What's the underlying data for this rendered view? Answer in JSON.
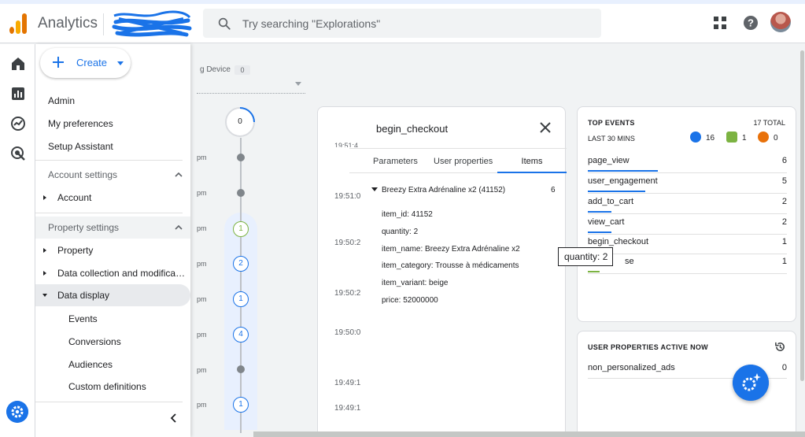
{
  "header": {
    "app_title": "Analytics",
    "search_placeholder": "Try searching \"Explorations\""
  },
  "menu": {
    "create_label": "Create",
    "items": {
      "admin": "Admin",
      "my_preferences": "My preferences",
      "setup_assistant": "Setup Assistant",
      "account_settings": "Account settings",
      "account": "Account",
      "property_settings": "Property settings",
      "property": "Property",
      "data_collection": "Data collection and modifica…",
      "data_display": "Data display",
      "events": "Events",
      "conversions": "Conversions",
      "audiences": "Audiences",
      "custom_definitions": "Custom definitions"
    }
  },
  "background": {
    "device_label": "g Device",
    "device_count": "0",
    "timeline_top_count": "0",
    "timeline_times": [
      "pm",
      "pm",
      "pm",
      "pm",
      "pm",
      "pm",
      "pm",
      "pm"
    ],
    "timeline_counts": [
      "1",
      "2",
      "1",
      "4",
      "1"
    ]
  },
  "detail": {
    "title": "begin_checkout",
    "sliver_time": "19:51:4",
    "tabs": [
      "Parameters",
      "User properties",
      "Items"
    ],
    "times": [
      "19:51:0",
      "19:50:2",
      "19:50:2",
      "19:50:0",
      "19:49:1",
      "19:49:1"
    ],
    "item_header": "Breezy Extra Adrénaline x2 (41152)",
    "item_count": "6",
    "properties": [
      "item_id: 41152",
      "quantity: 2",
      "item_name: Breezy Extra Adrénaline x2",
      "item_category: Trousse à médicaments",
      "item_variant: beige",
      "price: 52000000"
    ]
  },
  "tooltip": {
    "text": "quantity: 2"
  },
  "top_events": {
    "title": "TOP EVENTS",
    "total": "17 TOTAL",
    "subtitle": "LAST 30 MINS",
    "badges": [
      {
        "count": "16",
        "color": "#1a73e8"
      },
      {
        "count": "1",
        "color": "#7cb342"
      },
      {
        "count": "0",
        "color": "#e8710a"
      }
    ],
    "rows": [
      {
        "name": "page_view",
        "count": "6",
        "share": 0.35
      },
      {
        "name": "user_engagement",
        "count": "5",
        "share": 0.29
      },
      {
        "name": "add_to_cart",
        "count": "2",
        "share": 0.12
      },
      {
        "name": "view_cart",
        "count": "2",
        "share": 0.12
      },
      {
        "name": "begin_checkout",
        "count": "1",
        "share": 0.06
      },
      {
        "name": "se",
        "count": "1",
        "share": 0.06
      }
    ]
  },
  "user_properties": {
    "title": "USER PROPERTIES ACTIVE NOW",
    "rows": [
      {
        "name": "non_personalized_ads",
        "count": "0"
      }
    ]
  },
  "colors": {
    "accent": "#1a73e8",
    "brand_orange": "#e37400"
  }
}
